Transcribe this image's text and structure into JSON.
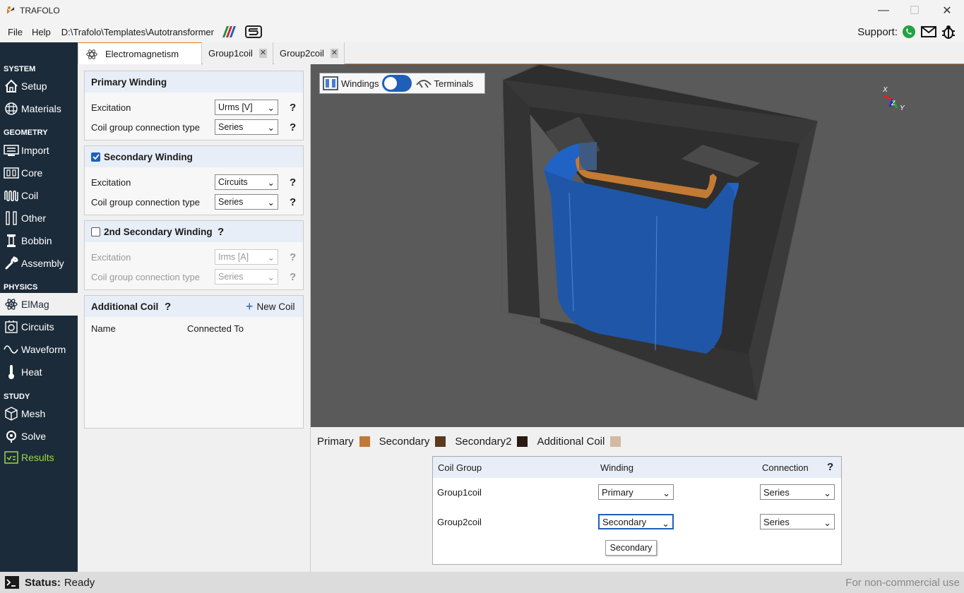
{
  "app": {
    "title": "TRAFOLO"
  },
  "menu": {
    "file": "File",
    "help": "Help",
    "path": "D:\\Trafolo\\Templates\\Autotransformer"
  },
  "support": {
    "label": "Support:"
  },
  "sidebar": {
    "sections": [
      {
        "title": "SYSTEM",
        "items": [
          "Setup",
          "Materials"
        ]
      },
      {
        "title": "GEOMETRY",
        "items": [
          "Import",
          "Core",
          "Coil",
          "Other",
          "Bobbin",
          "Assembly"
        ]
      },
      {
        "title": "PHYSICS",
        "items": [
          "ElMag",
          "Circuits",
          "Waveform",
          "Heat"
        ]
      },
      {
        "title": "STUDY",
        "items": [
          "Mesh",
          "Solve",
          "Results"
        ]
      }
    ]
  },
  "tabs": [
    {
      "label": "Electromagnetism",
      "icon": "atom-icon"
    },
    {
      "label": "Group1coil"
    },
    {
      "label": "Group2coil"
    }
  ],
  "primary": {
    "title": "Primary Winding",
    "excitation_label": "Excitation",
    "excitation_value": "Urms [V]",
    "connection_label": "Coil group connection type",
    "connection_value": "Series"
  },
  "secondary": {
    "title": "Secondary Winding",
    "checked": true,
    "excitation_label": "Excitation",
    "excitation_value": "Circuits",
    "connection_label": "Coil group connection type",
    "connection_value": "Series"
  },
  "secondary2": {
    "title": "2nd Secondary Winding",
    "checked": false,
    "excitation_label": "Excitation",
    "excitation_value": "Irms [A]",
    "connection_label": "Coil group connection type",
    "connection_value": "Series"
  },
  "additional": {
    "title": "Additional Coil",
    "new_coil": "New Coil",
    "col_name": "Name",
    "col_connected": "Connected To"
  },
  "help_mark": "?",
  "viewport": {
    "windings_label": "Windings",
    "terminals_label": "Terminals",
    "axes": {
      "x": "X",
      "y": "Y",
      "z": "Z"
    }
  },
  "legend": [
    {
      "label": "Primary",
      "color": "#c0793a"
    },
    {
      "label": "Secondary",
      "color": "#5a3a20"
    },
    {
      "label": "Secondary2",
      "color": "#2a1a12"
    },
    {
      "label": "Additional Coil",
      "color": "#d4b9a4"
    }
  ],
  "coil_table": {
    "headers": {
      "group": "Coil Group",
      "winding": "Winding",
      "connection": "Connection"
    },
    "rows": [
      {
        "group": "Group1coil",
        "winding": "Primary",
        "connection": "Series"
      },
      {
        "group": "Group2coil",
        "winding": "Secondary",
        "connection": "Series"
      }
    ],
    "tooltip": "Secondary"
  },
  "status": {
    "label": "Status:",
    "value": "Ready",
    "license": "For non-commercial use"
  },
  "colors": {
    "accent": "#e07b26",
    "sidebar_bg": "#1c2b3a",
    "coil_blue": "#1f5fb8",
    "results_green": "#9bd64a"
  }
}
